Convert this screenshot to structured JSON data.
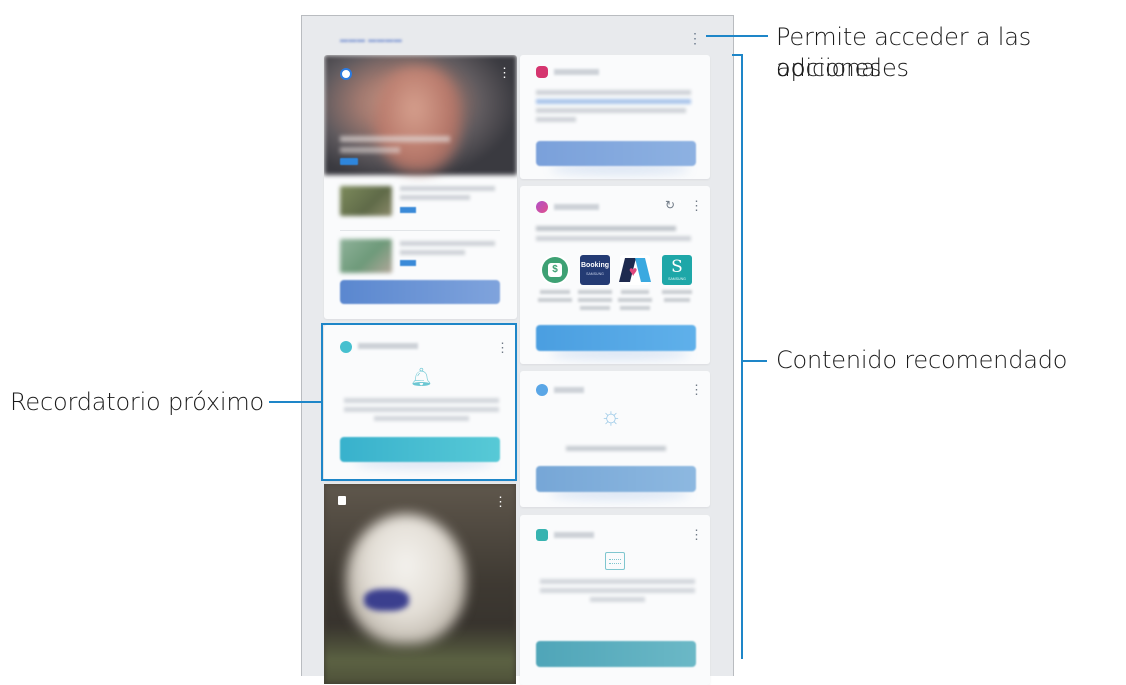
{
  "callouts": {
    "options": {
      "line1": "Permite acceder a las opciones",
      "line2": "adicionales"
    },
    "recommended": "Contenido recomendado",
    "reminder": "Recordatorio próximo"
  },
  "colors": {
    "accent_line": "#1e86c8",
    "button_blue": "#6f9ad9",
    "button_teal": "#45bcd0"
  },
  "screen": {
    "top_menu_icon": "more-vertical-icon"
  },
  "booking_tile": {
    "line1": "Booking",
    "line2": "SAMSUNG"
  },
  "samsung_tile": {
    "letter": "S",
    "caption": "SAMSUNG"
  }
}
